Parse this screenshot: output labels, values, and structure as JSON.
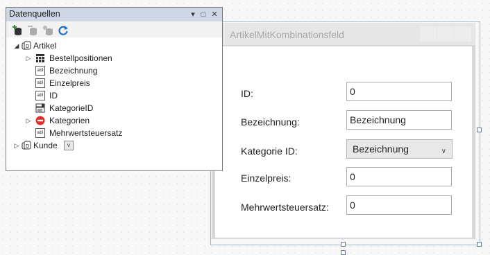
{
  "panel": {
    "title": "Datenquellen",
    "title_buttons": {
      "dropdown": "▾",
      "maximize": "□",
      "close": "✕"
    },
    "toolbar": [
      "add-datasource-icon",
      "edit-datasource-icon",
      "configure-datasource-icon",
      "refresh-icon"
    ],
    "tree": {
      "artikel": {
        "label": "Artikel",
        "children": [
          {
            "label": "Bestellpositionen",
            "icon": "datagrid-icon",
            "expandable": true
          },
          {
            "label": "Bezeichnung",
            "icon": "textbox-icon"
          },
          {
            "label": "Einzelpreis",
            "icon": "textbox-icon"
          },
          {
            "label": "ID",
            "icon": "textbox-icon"
          },
          {
            "label": "KategorieID",
            "icon": "combobox-icon"
          },
          {
            "label": "Kategorien",
            "icon": "none-icon",
            "expandable": true
          },
          {
            "label": "Mehrwertsteuersatz",
            "icon": "textbox-icon"
          }
        ]
      },
      "kunde": {
        "label": "Kunde",
        "dropdown": "v"
      }
    }
  },
  "form": {
    "title": "ArtikelMitKombinationsfeld",
    "fields": [
      {
        "label": "ID:",
        "value": "0"
      },
      {
        "label": "Bezeichnung:",
        "value": "Bezeichnung"
      },
      {
        "label": "Kategorie ID:",
        "value": "Bezeichnung"
      },
      {
        "label": "Einzelpreis:",
        "value": "0"
      },
      {
        "label": "Mehrwertsteuersatz:",
        "value": "0"
      }
    ]
  },
  "colors": {
    "panel_title_bg": "#cfd6e5",
    "refresh_icon": "#1e6fc9",
    "none_icon": "#e0302a"
  }
}
